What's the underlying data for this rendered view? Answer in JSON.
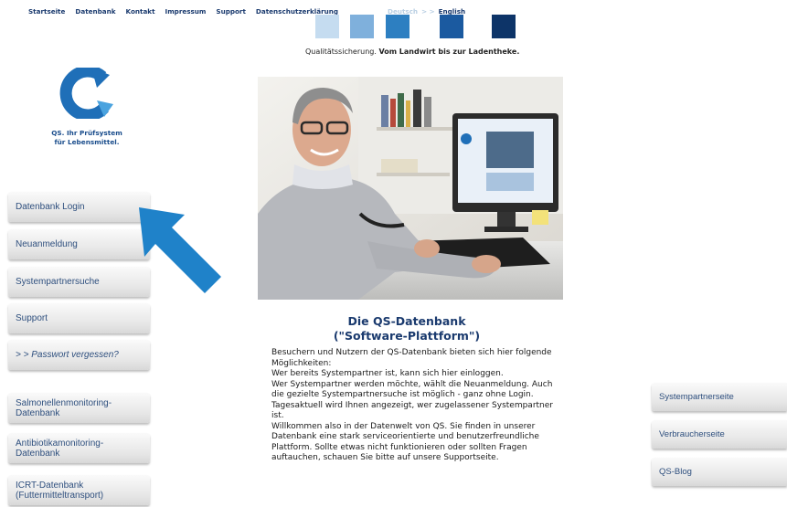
{
  "topnav": {
    "items": [
      "Startseite",
      "Datenbank",
      "Kontakt",
      "Impressum",
      "Support",
      "Datenschutzerklärung"
    ],
    "lang_de": "Deutsch",
    "lang_sep": "> >",
    "lang_en": "English"
  },
  "swatches": [
    "#c5dcf0",
    "#7fb0dc",
    "#2d7fc1",
    "#1b5aa0",
    "#0d3468"
  ],
  "tagline": {
    "normal": "Qualitätssicherung. ",
    "bold": "Vom Landwirt bis zur Ladentheke."
  },
  "logo": {
    "line1": "QS. Ihr Prüfsystem",
    "line2": "für Lebensmittel."
  },
  "left_menu": [
    {
      "label": "Datenbank Login"
    },
    {
      "label": "Neuanmeldung"
    },
    {
      "label": "Systempartnersuche"
    },
    {
      "label": "Support"
    },
    {
      "label": "> > Passwort vergessen?"
    },
    {
      "label": "Salmonellenmonitoring-\nDatenbank"
    },
    {
      "label": "Antibiotikamonitoring-\nDatenbank"
    },
    {
      "label": "ICRT-Datenbank\n(Futtermitteltransport)"
    }
  ],
  "main": {
    "title_line1": "Die QS-Datenbank",
    "title_line2": "(\"Software-Plattform\")",
    "body": "Besuchern und Nutzern der QS-Datenbank bieten sich hier folgende Möglichkeiten:\nWer bereits Systempartner ist, kann sich hier einloggen.\nWer Systempartner werden möchte, wählt die Neuanmeldung. Auch die gezielte Systempartnersuche ist möglich - ganz ohne Login. Tagesaktuell wird Ihnen angezeigt, wer zugelassener Systempartner ist.\nWillkommen also in der Datenwelt von QS. Sie finden in unserer Datenbank eine stark serviceorientierte und benutzerfreundliche Plattform. Sollte etwas nicht funktionieren oder sollten Fragen auftauchen, schauen Sie bitte auf unsere Supportseite."
  },
  "right_menu": [
    {
      "label": "Systempartnerseite"
    },
    {
      "label": "Verbraucherseite"
    },
    {
      "label": "QS-Blog"
    }
  ],
  "colors": {
    "brand_blue": "#1a3a6e",
    "arrow_blue": "#1f82c9",
    "link_blue": "#2e4f7e"
  }
}
